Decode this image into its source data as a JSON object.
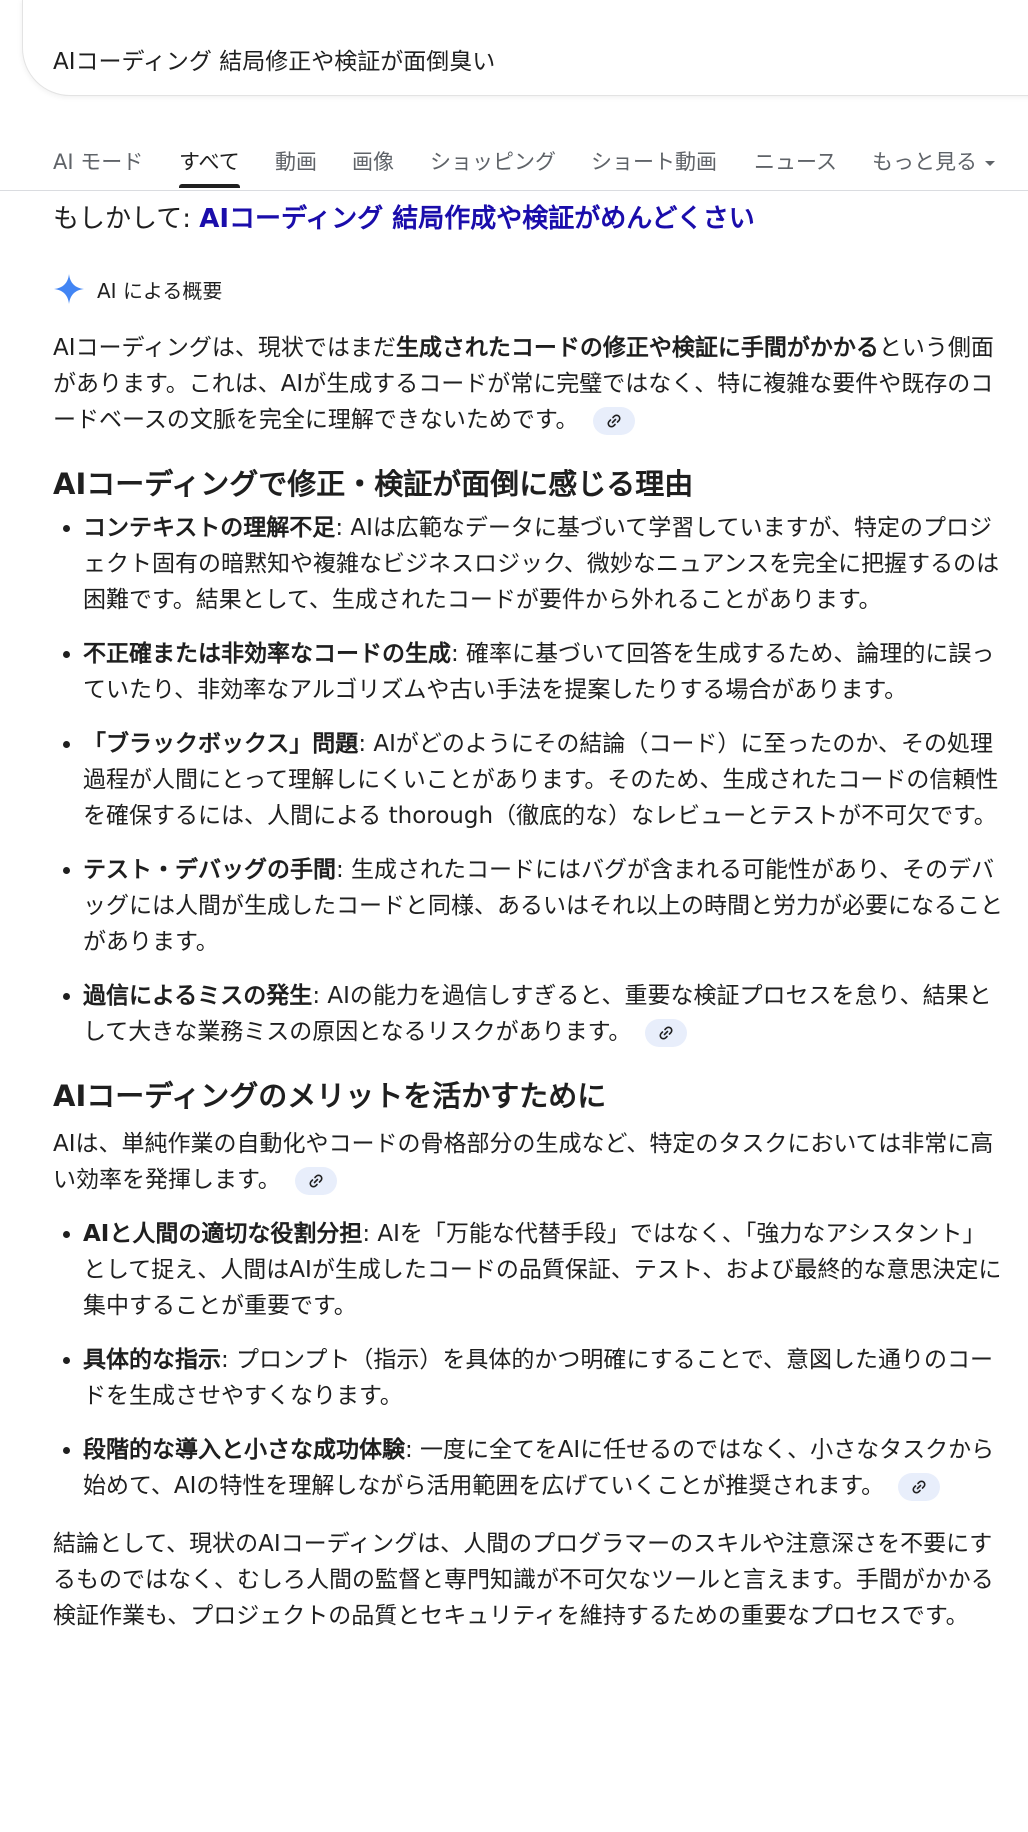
{
  "search": {
    "query": "AIコーディング 結局修正や検証が面倒臭い"
  },
  "tabs": [
    {
      "label": "AI モード"
    },
    {
      "label": "すべて"
    },
    {
      "label": "動画"
    },
    {
      "label": "画像"
    },
    {
      "label": "ショッピング"
    },
    {
      "label": "ショート動画"
    },
    {
      "label": "ニュース"
    },
    {
      "label": "もっと見る"
    }
  ],
  "did_you_mean": {
    "prefix": "もしかして: ",
    "suggestion": "AIコーディング 結局作成や検証がめんどくさい"
  },
  "ai_overview": {
    "label": "AI による概要",
    "intro": {
      "pre": "AIコーディングは、現状ではまだ",
      "bold": "生成されたコードの修正や検証に手間がかかる",
      "post": "という側面があります。これは、AIが生成するコードが常に完璧ではなく、特に複雑な要件や既存のコードベースの文脈を完全に理解できないためです。"
    },
    "section1": {
      "heading": "AIコーディングで修正・検証が面倒に感じる理由",
      "items": [
        {
          "bold": "コンテキストの理解不足",
          "text": ": AIは広範なデータに基づいて学習していますが、特定のプロジェクト固有の暗黙知や複雑なビジネスロジック、微妙なニュアンスを完全に把握するのは困難です。結果として、生成されたコードが要件から外れることがあります。"
        },
        {
          "bold": "不正確または非効率なコードの生成",
          "text": ": 確率に基づいて回答を生成するため、論理的に誤っていたり、非効率なアルゴリズムや古い手法を提案したりする場合があります。"
        },
        {
          "bold": "「ブラックボックス」問題",
          "text": ": AIがどのようにその結論（コード）に至ったのか、その処理過程が人間にとって理解しにくいことがあります。そのため、生成されたコードの信頼性を確保するには、人間による thorough（徹底的な）なレビューとテストが不可欠です。"
        },
        {
          "bold": "テスト・デバッグの手間",
          "text": ": 生成されたコードにはバグが含まれる可能性があり、そのデバッグには人間が生成したコードと同様、あるいはそれ以上の時間と労力が必要になることがあります。"
        },
        {
          "bold": "過信によるミスの発生",
          "text": ": AIの能力を過信しすぎると、重要な検証プロセスを怠り、結果として大きな業務ミスの原因となるリスクがあります。"
        }
      ]
    },
    "section2": {
      "heading": "AIコーディングのメリットを活かすために",
      "intro": "AIは、単純作業の自動化やコードの骨格部分の生成など、特定のタスクにおいては非常に高い効率を発揮します。",
      "items": [
        {
          "bold": "AIと人間の適切な役割分担",
          "text": ": AIを「万能な代替手段」ではなく、「強力なアシスタント」として捉え、人間はAIが生成したコードの品質保証、テスト、および最終的な意思決定に集中することが重要です。"
        },
        {
          "bold": "具体的な指示",
          "text": ": プロンプト（指示）を具体的かつ明確にすることで、意図した通りのコードを生成させやすくなります。"
        },
        {
          "bold": "段階的な導入と小さな成功体験",
          "text": ": 一度に全てをAIに任せるのではなく、小さなタスクから始めて、AIの特性を理解しながら活用範囲を広げていくことが推奨されます。"
        }
      ]
    },
    "conclusion": "結論として、現状のAIコーディングは、人間のプログラマーのスキルや注意深さを不要にするものではなく、むしろ人間の監督と専門知識が不可欠なツールと言えます。手間がかかる検証作業も、プロジェクトの品質とセキュリティを維持するための重要なプロセスです。"
  },
  "colors": {
    "link": "#1a0dab",
    "sparkle": "#4285f4",
    "chip": "#e8eefb"
  },
  "icons": [
    "sparkle-icon",
    "link-icon",
    "caret-down-icon"
  ]
}
